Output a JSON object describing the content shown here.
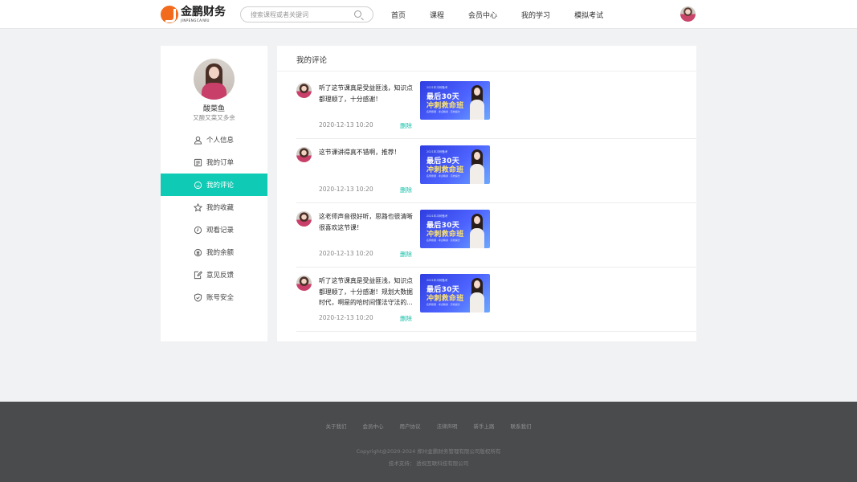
{
  "header": {
    "logo_cn": "金鹏财务",
    "logo_en": "JINPENGCAIWU",
    "search_placeholder": "搜索课程或者关键词",
    "nav": [
      "首页",
      "课程",
      "会员中心",
      "我的学习",
      "模拟考试"
    ]
  },
  "sidebar": {
    "username": "酸菜鱼",
    "motto": "又酸又菜又多余",
    "menu": [
      {
        "label": "个人信息",
        "icon": "user-icon",
        "active": false
      },
      {
        "label": "我的订单",
        "icon": "order-icon",
        "active": false
      },
      {
        "label": "我的评论",
        "icon": "comment-icon",
        "active": true
      },
      {
        "label": "我的收藏",
        "icon": "star-icon",
        "active": false
      },
      {
        "label": "观看记录",
        "icon": "clock-icon",
        "active": false
      },
      {
        "label": "我的余额",
        "icon": "balance-icon",
        "active": false
      },
      {
        "label": "意见反馈",
        "icon": "feedback-icon",
        "active": false
      },
      {
        "label": "账号安全",
        "icon": "shield-icon",
        "active": false
      }
    ]
  },
  "main": {
    "title": "我的评论",
    "delete_label": "删除",
    "comments": [
      {
        "text": "听了这节课真是受益匪浅，知识点都理顺了，十分感谢！",
        "time": "2020-12-13  10:20"
      },
      {
        "text": "这节课讲得真不错啊，推荐！",
        "time": "2020-12-13  10:20"
      },
      {
        "text": "这老师声音很好听，思路也很清晰很喜欢这节课！",
        "time": "2020-12-13  10:20"
      },
      {
        "text": "听了这节课真是受益匪浅，知识点都理顺了，十分感谢！规划大数据时代，啊是的哈时间懂法守法的...",
        "time": "2020-12-13  10:20"
      }
    ],
    "thumb": {
      "small": "2021年冲刺备考",
      "line1": "最后30天",
      "line2": "冲刺救命班",
      "tags": "名师授课 · 考点精讲 · 高效提分"
    }
  },
  "footer": {
    "links": [
      "关于我们",
      "会员中心",
      "用户协议",
      "法律声明",
      "新手上路",
      "联系我们"
    ],
    "copyright": "Copyright@2020-2024 郑州金鹏财务管理有限公司版权所有",
    "tech": "技术支持：  透视互联科技有限公司"
  },
  "colors": {
    "accent": "#0fcab4",
    "logo_orange": "#f26a1b",
    "footer_bg": "#4a4b4d"
  }
}
